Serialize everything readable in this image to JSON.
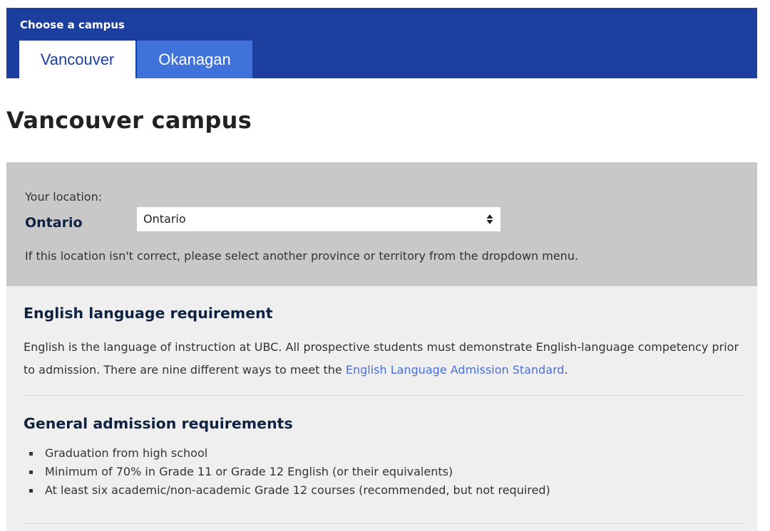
{
  "campus_selector": {
    "title": "Choose a campus",
    "tabs": [
      {
        "label": "Vancouver",
        "active": true
      },
      {
        "label": "Okanagan",
        "active": false
      }
    ]
  },
  "page": {
    "title": "Vancouver campus"
  },
  "location": {
    "label": "Your location:",
    "current": "Ontario",
    "select_value": "Ontario",
    "note": "If this location isn't correct, please select another province or territory from the dropdown menu."
  },
  "english_requirement": {
    "heading": "English language requirement",
    "body": "English is the language of instruction at UBC. All prospective students must demonstrate English-language competency prior to admission. There are nine different ways to meet the ",
    "link_text": "English Language Admission Standard",
    "body_end": "."
  },
  "general_requirements": {
    "heading": "General admission requirements",
    "items": [
      "Graduation from high school",
      "Minimum of 70% in Grade 11 or Grade 12 English (or their equivalents)",
      "At least six academic/non-academic Grade 12 courses (recommended, but not required)"
    ]
  },
  "colors": {
    "campus_bar": "#1c3f9f",
    "inactive_tab": "#3f73db",
    "location_panel": "#c8c8c8",
    "content_panel": "#efefef",
    "link": "#4a6fd8",
    "heading": "#0f2340"
  }
}
